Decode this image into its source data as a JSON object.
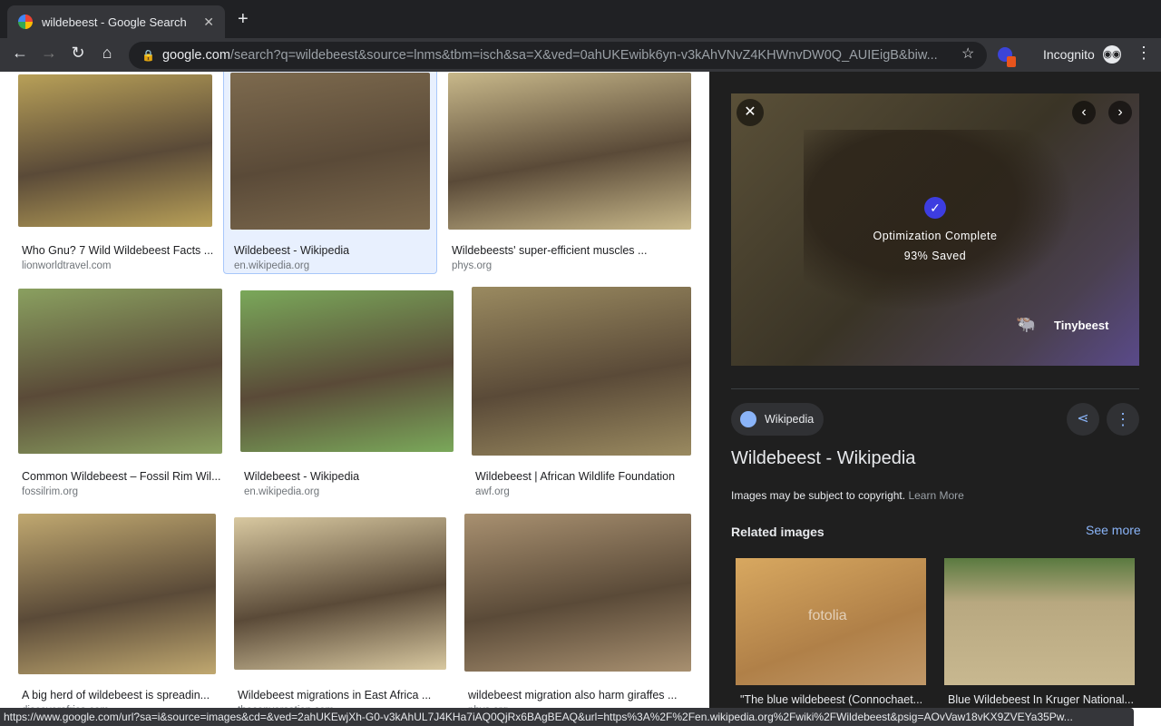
{
  "browser": {
    "tab_title": "wildebeest - Google Search",
    "new_tab": "+",
    "url_host": "google.com",
    "url_path": "/search?q=wildebeest&source=lnms&tbm=isch&sa=X&ved=0ahUKEwibk6yn-v3kAhVNvZ4KHWnvDW0Q_AUIEigB&biw...",
    "profile": "Incognito"
  },
  "results": [
    {
      "title": "Who Gnu? 7 Wild Wildebeest Facts ...",
      "source": "lionworldtravel.com",
      "color": "#b8a058"
    },
    {
      "title": "Wildebeest - Wikipedia",
      "source": "en.wikipedia.org",
      "color": "#7d6a4e",
      "selected": true
    },
    {
      "title": "Wildebeests' super-efficient muscles ...",
      "source": "phys.org",
      "color": "#c8b88a"
    },
    {
      "title": "Common Wildebeest – Fossil Rim Wil...",
      "source": "fossilrim.org",
      "color": "#8aa060"
    },
    {
      "title": "Wildebeest - Wikipedia",
      "source": "en.wikipedia.org",
      "color": "#7aa85a"
    },
    {
      "title": "Wildebeest | African Wildlife Foundation",
      "source": "awf.org",
      "color": "#9a8a60"
    },
    {
      "title": "A big herd of wildebeest is spreadin...",
      "source": "discoverafrica.com",
      "color": "#c0a870"
    },
    {
      "title": "Wildebeest migrations in East Africa ...",
      "source": "theconversation.com",
      "color": "#d8c8a0"
    },
    {
      "title": "wildebeest migration also harm giraffes ...",
      "source": "phys.org",
      "color": "#a89070"
    }
  ],
  "preview": {
    "overlay_title": "Optimization Complete",
    "overlay_saved": "93% Saved",
    "brand": "Tinybeest",
    "source_chip": "Wikipedia",
    "title": "Wildebeest - Wikipedia",
    "copyright": "Images may be subject to copyright.",
    "learn_more": "Learn More",
    "related_heading": "Related images",
    "see_more": "See more",
    "related": [
      {
        "title": "\"The blue wildebeest (Connochaet...",
        "watermark": "fotolia"
      },
      {
        "title": "Blue Wildebeest In Kruger National..."
      }
    ]
  },
  "status_url": "https://www.google.com/url?sa=i&source=images&cd=&ved=2ahUKEwjXh-G0-v3kAhUL7J4KHa7iAQ0QjRx6BAgBEAQ&url=https%3A%2F%2Fen.wikipedia.org%2Fwiki%2FWildebeest&psig=AOvVaw18vKX9ZVEYa35Pw..."
}
